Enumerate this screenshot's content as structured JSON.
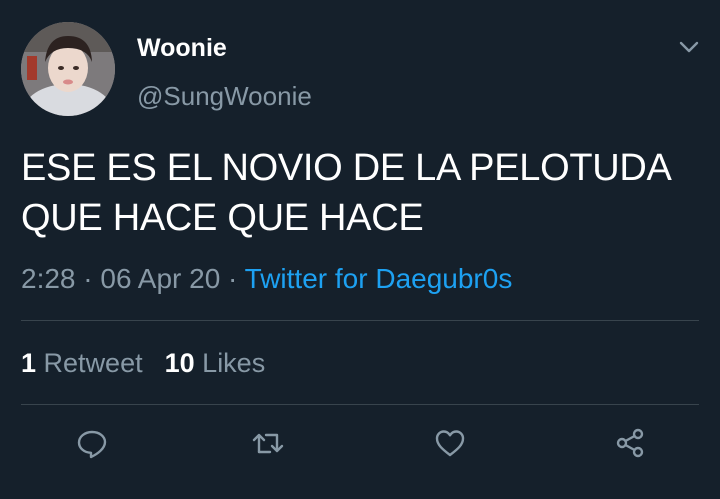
{
  "author": {
    "display_name": "Woonie",
    "handle": "@SungWoonie"
  },
  "tweet": {
    "text_line1": "ESE ES EL NOVIO DE LA PELOTUDA",
    "text_line2": "QUE HACE QUE HACE",
    "time": "2:28",
    "separator": " · ",
    "date": "06 Apr 20",
    "source": "Twitter for Daegubr0s"
  },
  "stats": {
    "retweet_count": "1",
    "retweet_label": "Retweet",
    "like_count": "10",
    "like_label": "Likes"
  },
  "actions": [
    "reply-icon",
    "retweet-icon",
    "like-icon",
    "share-icon"
  ],
  "colors": {
    "background": "#15202b",
    "text": "#ffffff",
    "muted": "#8899a6",
    "link": "#1da1f2",
    "divider": "#38444d"
  }
}
